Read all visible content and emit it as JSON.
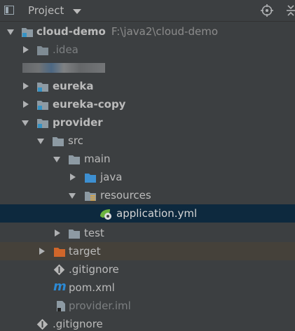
{
  "header": {
    "title": "Project",
    "icons": [
      "project-panel-icon",
      "dropdown-caret-icon",
      "locate-target-icon",
      "collapse-all-icon"
    ]
  },
  "tree": {
    "root": {
      "name": "cloud-demo",
      "path": "F:\\java2\\cloud-demo"
    },
    "idea": ".idea",
    "eureka": "eureka",
    "eureka_copy": "eureka-copy",
    "provider": "provider",
    "src": "src",
    "main": "main",
    "java": "java",
    "resources": "resources",
    "application_yml": "application.yml",
    "test": "test",
    "target": "target",
    "gitignore_inner": ".gitignore",
    "pom": "pom.xml",
    "iml": "provider.iml",
    "gitignore_root": ".gitignore"
  },
  "colors": {
    "panel_bg": "#3c3f41",
    "selection_bg": "#0d293e",
    "excluded_bg": "#45413a",
    "folder_grey": "#8d9aa3",
    "module_blue": "#3592c4",
    "source_blue": "#3d8fd1",
    "excluded_orange": "#d0662a",
    "maven_blue": "#2c8ad5"
  }
}
